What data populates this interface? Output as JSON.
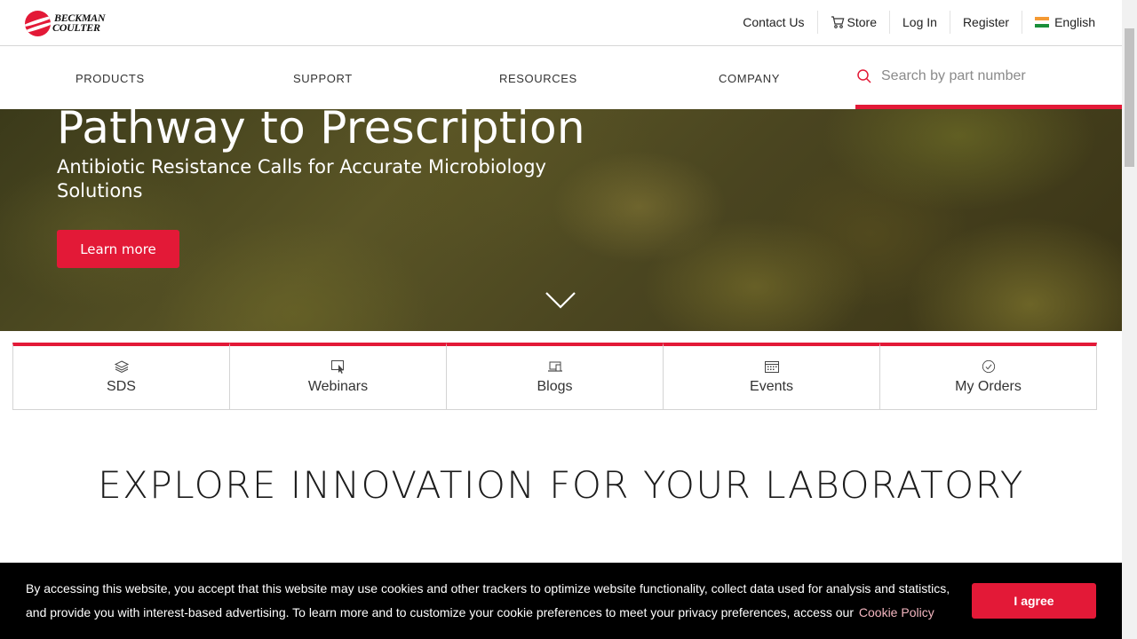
{
  "brand": {
    "logo_line1": "BECKMAN",
    "logo_line2": "COULTER",
    "accent_color": "#e31937"
  },
  "utility_nav": {
    "contact": "Contact Us",
    "store": "Store",
    "login": "Log In",
    "register": "Register",
    "language": "English"
  },
  "main_nav": {
    "products": "PRODUCTS",
    "support": "SUPPORT",
    "resources": "RESOURCES",
    "company": "COMPANY",
    "search_placeholder": "Search by part number"
  },
  "hero": {
    "title": "Pathway to Prescription",
    "subtitle": "Antibiotic Resistance Calls for Accurate Microbiology Solutions",
    "cta": "Learn more"
  },
  "quick_links": [
    {
      "label": "SDS",
      "icon": "layers-icon"
    },
    {
      "label": "Webinars",
      "icon": "monitor-cursor-icon"
    },
    {
      "label": "Blogs",
      "icon": "laptop-icon"
    },
    {
      "label": "Events",
      "icon": "calendar-icon"
    },
    {
      "label": "My Orders",
      "icon": "check-circle-icon"
    }
  ],
  "section": {
    "heading": "EXPLORE INNOVATION FOR YOUR LABORATORY"
  },
  "cookie_banner": {
    "text": "By accessing this website, you accept that this website may use cookies and other trackers to optimize website functionality, collect data used for analysis and statistics, and provide you with interest-based advertising. To learn more and to customize your cookie preferences to meet your privacy preferences, access our",
    "link": "Cookie Policy",
    "button": "I agree"
  }
}
